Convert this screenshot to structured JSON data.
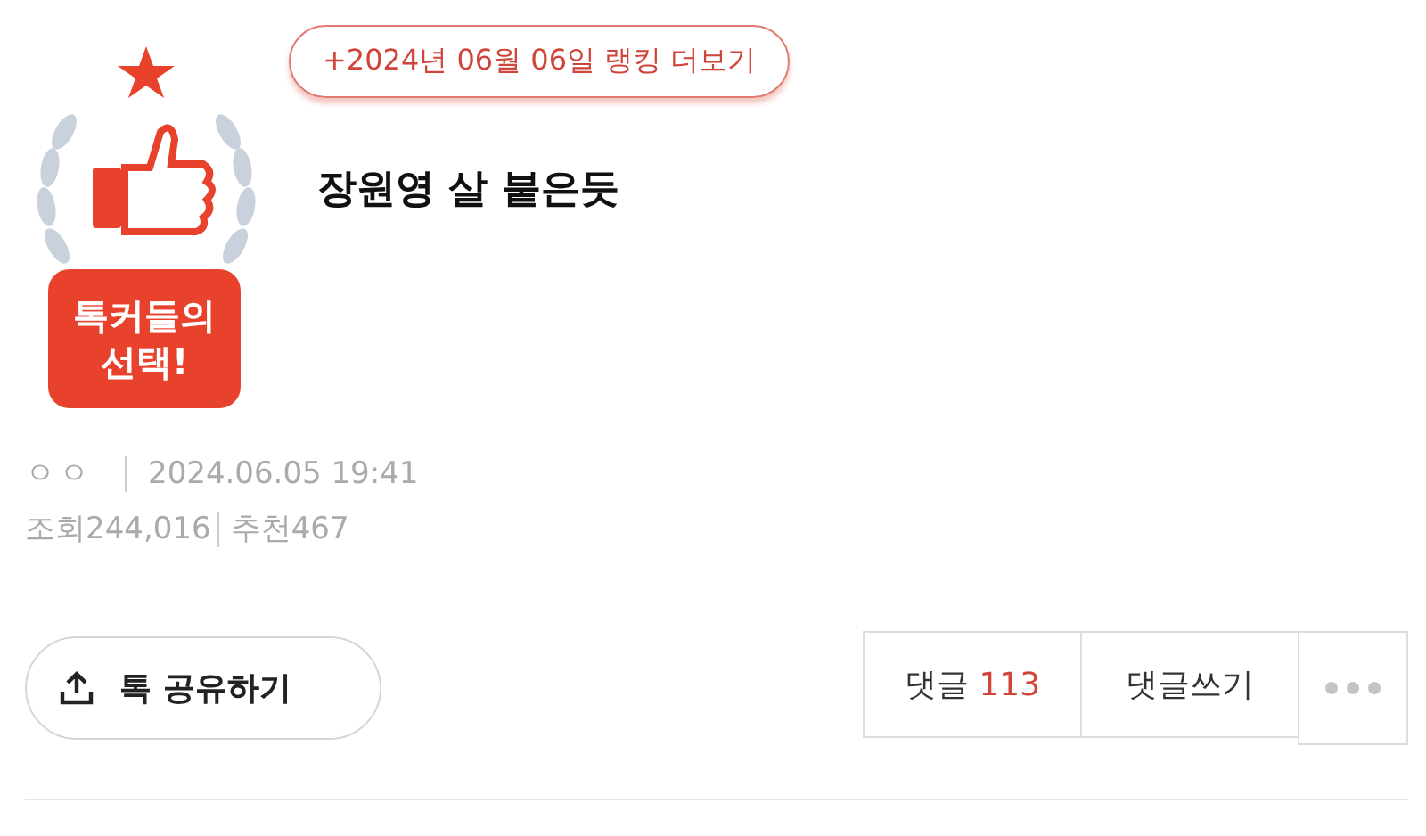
{
  "badge": {
    "lines": [
      "톡커들의",
      "선택!"
    ]
  },
  "ranking_link": "+2024년 06월 06일 랭킹 더보기",
  "title": "장원영 살 붙은듯",
  "meta": {
    "author": "ㅇㅇ",
    "datetime": "2024.06.05 19:41",
    "views": "조회244,016",
    "recommends": "추천467"
  },
  "share_button": "톡 공유하기",
  "comments_button": {
    "label": "댓글",
    "count": "113"
  },
  "write_comment_button": "댓글쓰기"
}
